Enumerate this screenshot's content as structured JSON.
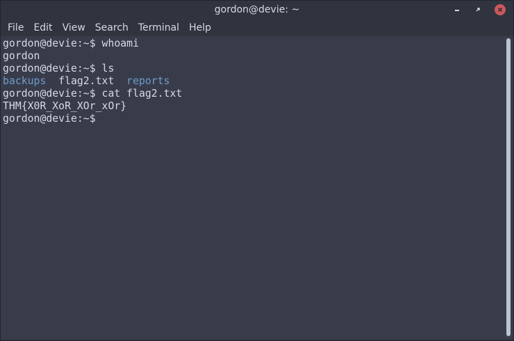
{
  "window": {
    "title": "gordon@devie: ~"
  },
  "menu": {
    "items": [
      "File",
      "Edit",
      "View",
      "Search",
      "Terminal",
      "Help"
    ]
  },
  "terminal": {
    "lines": [
      {
        "parts": [
          {
            "text": "gordon@devie:~$ whoami",
            "kind": "text"
          }
        ]
      },
      {
        "parts": [
          {
            "text": "gordon",
            "kind": "text"
          }
        ]
      },
      {
        "parts": [
          {
            "text": "gordon@devie:~$ ls",
            "kind": "text"
          }
        ]
      },
      {
        "parts": [
          {
            "text": "backups",
            "kind": "dir"
          },
          {
            "text": "  flag2.txt  ",
            "kind": "text"
          },
          {
            "text": "reports",
            "kind": "dir"
          }
        ]
      },
      {
        "parts": [
          {
            "text": "gordon@devie:~$ cat flag2.txt",
            "kind": "text"
          }
        ]
      },
      {
        "parts": [
          {
            "text": "THM{X0R_XoR_XOr_xOr}",
            "kind": "text"
          }
        ]
      },
      {
        "parts": [
          {
            "text": "gordon@devie:~$ ",
            "kind": "text"
          }
        ]
      }
    ]
  },
  "colors": {
    "background": "#383c4a",
    "chrome": "#2f343f",
    "text": "#d3dae3",
    "directory": "#6d9ac9",
    "close_button": "#cc575d"
  },
  "icons": {
    "minimize": "minimize-icon",
    "maximize": "maximize-icon",
    "close": "close-icon"
  }
}
